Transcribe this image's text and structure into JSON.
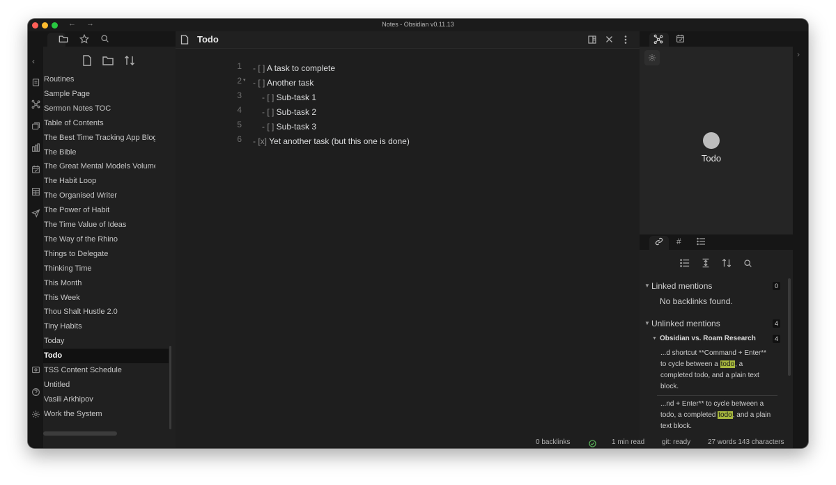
{
  "window": {
    "title": "Notes - Obsidian v0.11.13"
  },
  "ribbon": {
    "icons": [
      "open-quick-switcher-icon",
      "graph-view-icon",
      "slides-icon",
      "templates-icon",
      "daily-note-icon",
      "kanban-icon",
      "publish-icon",
      "vault-icon",
      "help-icon",
      "settings-icon"
    ]
  },
  "file_explorer": {
    "items": [
      "Routines",
      "Sample Page",
      "Sermon Notes TOC",
      "Table of Contents",
      "The Best Time Tracking App Blog",
      "The Bible",
      "The Great Mental Models Volume",
      "The Habit Loop",
      "The Organised Writer",
      "The Power of Habit",
      "The Time Value of Ideas",
      "The Way of the Rhino",
      "Things to Delegate",
      "Thinking Time",
      "This Month",
      "This Week",
      "Thou Shalt Hustle 2.0",
      "Tiny Habits",
      "Today",
      "Todo",
      "TSS Content Schedule",
      "Untitled",
      "Vasili Arkhipov",
      "Work the System"
    ],
    "active": "Todo"
  },
  "editor": {
    "title": "Todo",
    "line_numbers": [
      "1",
      "2",
      "3",
      "4",
      "5",
      "6"
    ],
    "lines": [
      {
        "prefix": "- [ ] ",
        "text": "A task to complete"
      },
      {
        "prefix": "- [ ] ",
        "text": "Another task"
      },
      {
        "prefix": "- [ ] ",
        "text": "Sub-task 1"
      },
      {
        "prefix": "- [ ] ",
        "text": "Sub-task 2"
      },
      {
        "prefix": "- [ ] ",
        "text": "Sub-task 3"
      },
      {
        "prefix": "- [x] ",
        "text": "Yet another task (but this one is done)"
      }
    ],
    "fold_marker": "▾"
  },
  "graph": {
    "node_label": "Todo"
  },
  "backlinks": {
    "linked_label": "Linked mentions",
    "linked_count": "0",
    "no_backlinks": "No backlinks found.",
    "unlinked_label": "Unlinked mentions",
    "unlinked_count": "4",
    "file_label": "Obsidian vs. Roam Research",
    "file_count": "4",
    "snippet1_before": "...d shortcut **Command + Enter** to cycle between a ",
    "snippet1_hl": "todo",
    "snippet1_after": ", a completed todo, and a plain text block.",
    "snippet2_before": "...nd + Enter** to cycle between a todo, a completed ",
    "snippet2_hl": "todo",
    "snippet2_after": ", and a plain text block."
  },
  "status": {
    "backlinks": "0 backlinks",
    "read_time": "1 min read",
    "git": "git: ready",
    "counts": "27 words 143 characters"
  },
  "colors": {
    "accent_highlight": "#a7b83e",
    "status_ok": "#5cb85c"
  }
}
